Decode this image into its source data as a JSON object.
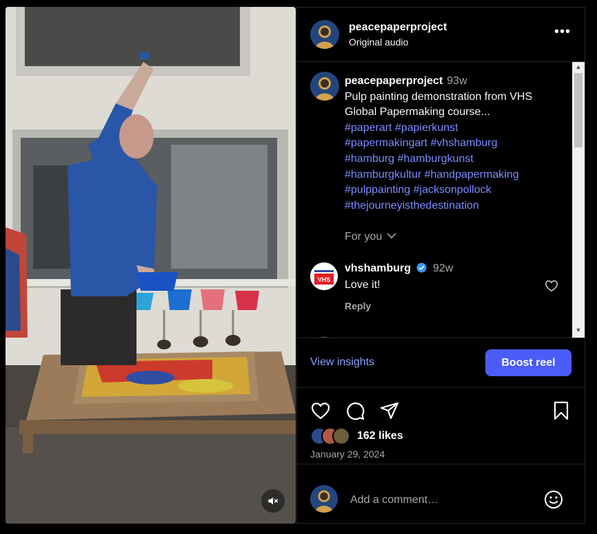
{
  "post": {
    "username": "peacepaperproject",
    "audio": "Original audio",
    "more_icon": "more-horizontal-icon",
    "media_type": "reel video"
  },
  "caption": {
    "username": "peacepaperproject",
    "time": "93w",
    "text": "Pulp painting demonstration from VHS Global Papermaking course...",
    "hashtags": [
      "#paperart",
      "#papierkunst",
      "#papermakingart",
      "#vhshamburg",
      "#hamburg",
      "#hamburgkunst",
      "#hamburgkultur",
      "#handpapermaking",
      "#pulppainting",
      "#jacksonpollock",
      "#thejourneyisthedestination"
    ],
    "for_you": "For you"
  },
  "comments": [
    {
      "username": "vhshamburg",
      "verified": true,
      "time": "92w",
      "text": "Love it!",
      "reply_label": "Reply",
      "avatar_text": "VHS"
    }
  ],
  "insights": {
    "view_label": "View insights",
    "boost_label": "Boost reel"
  },
  "actions": {
    "likes": "162 likes",
    "date": "January 29, 2024"
  },
  "comment_box": {
    "placeholder": "Add a comment…"
  },
  "colors": {
    "accent": "#4a5df9",
    "hashtag": "#7b8cff",
    "link": "#8ea2ff",
    "verified": "#3797f0",
    "muted": "#a8a8a8"
  }
}
